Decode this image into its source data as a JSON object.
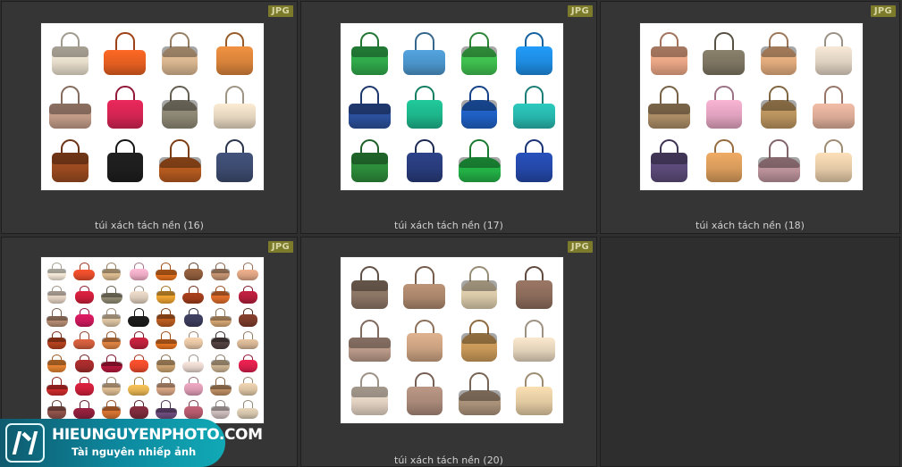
{
  "gallery": {
    "items": [
      {
        "caption": "túi xách tách nền (16)",
        "badge": "JPG",
        "cols": 4,
        "bags": [
          "#e6dccb",
          "#e25d20",
          "#d8b58f",
          "#d7823a",
          "#c09a86",
          "#d22452",
          "#8c8674",
          "#e2d3bd",
          "#9a4a20",
          "#1d1d1d",
          "#b3591f",
          "#3c4a6e"
        ]
      },
      {
        "caption": "túi xách tách nền (17)",
        "badge": "JPG",
        "cols": 4,
        "bags": [
          "#2fa84a",
          "#4a92c8",
          "#3fbe4e",
          "#1e8be0",
          "#2b4f9a",
          "#1db48a",
          "#1f5fc2",
          "#27b4aa",
          "#2c8b3a",
          "#283b7a",
          "#23b046",
          "#2448a8"
        ]
      },
      {
        "caption": "túi xách tách nền (18)",
        "badge": "JPG",
        "cols": 4,
        "bags": [
          "#e8a585",
          "#7b7360",
          "#e0aa7c",
          "#ddd0c0",
          "#a88a64",
          "#dfa1bd",
          "#b8925e",
          "#d8a995",
          "#5b4a78",
          "#d69a5a",
          "#b99098",
          "#e2c8a5"
        ]
      },
      {
        "caption": "",
        "badge": "JPG",
        "cols": 8,
        "bags": [
          "#efe4d4",
          "#e04a2a",
          "#d7b88e",
          "#e8a8c0",
          "#e0701e",
          "#8a5a3a",
          "#c09070",
          "#d8a080",
          "#e0d0c0",
          "#c81e3a",
          "#8c8670",
          "#d8c8b8",
          "#e8a030",
          "#9a3a1a",
          "#d86a2a",
          "#b01e3a",
          "#b08870",
          "#c8185a",
          "#d8c0a0",
          "#1a1a1a",
          "#b55a20",
          "#3a3a5a",
          "#cfa070",
          "#7a3a2a",
          "#b0401e",
          "#c85a3a",
          "#d88040",
          "#b8203a",
          "#e07020",
          "#e0c0a0",
          "#504040",
          "#d0b090",
          "#e08030",
          "#a02a2a",
          "#b0183a",
          "#e84a2a",
          "#c8a070",
          "#e0d0c8",
          "#c8b090",
          "#d81e4a",
          "#c82a2a",
          "#c81e3a",
          "#d8b890",
          "#e0b050",
          "#d0a080",
          "#d898b0",
          "#b88a60",
          "#d8c0a0",
          "#8a5048",
          "#8a1e3a",
          "#d07030",
          "#7a2a3a",
          "#6a4a7a",
          "#b0586a",
          "#c8b8b8",
          "#d0c0a8"
        ]
      },
      {
        "caption": "túi xách tách nền (20)",
        "badge": "JPG",
        "cols": 4,
        "bags": [
          "#8a7464",
          "#a8846a",
          "#d8c8a8",
          "#8a6a5a",
          "#b89888",
          "#c8a080",
          "#c89858",
          "#e0d0b8",
          "#e0d0c0",
          "#a88878",
          "#a89078",
          "#e0c8a0"
        ]
      }
    ]
  },
  "watermark": {
    "site": "HIEUNGUYENPHOTO.COM",
    "tagline": "Tài nguyên nhiếp ảnh"
  }
}
